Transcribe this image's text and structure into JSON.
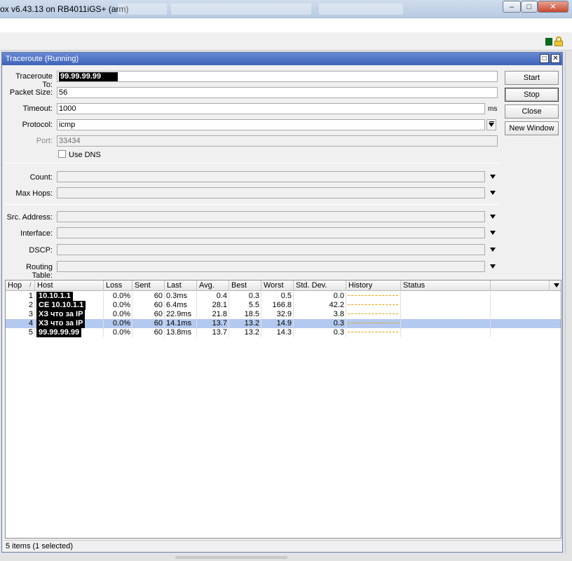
{
  "app": {
    "title": "ox v6.43.13 on RB4011iGS+ (arm)",
    "controls": {
      "minimize": "–",
      "maximize": "□",
      "close": "✕"
    },
    "accent": "#3f63b8"
  },
  "window": {
    "title": "Traceroute (Running)",
    "restore_glyph": "□",
    "close_glyph": "✕"
  },
  "form": {
    "traceroute_to": {
      "label": "Traceroute To:",
      "value": "99.99.99.99"
    },
    "packet_size": {
      "label": "Packet Size:",
      "value": "56"
    },
    "timeout": {
      "label": "Timeout:",
      "value": "1000",
      "unit": "ms"
    },
    "protocol": {
      "label": "Protocol:",
      "value": "icmp"
    },
    "port": {
      "label": "Port:",
      "value": "33434"
    },
    "use_dns": {
      "label": "Use DNS",
      "checked": false
    },
    "count": {
      "label": "Count:",
      "value": ""
    },
    "max_hops": {
      "label": "Max Hops:",
      "value": ""
    },
    "src_address": {
      "label": "Src. Address:",
      "value": ""
    },
    "interface": {
      "label": "Interface:",
      "value": ""
    },
    "dscp": {
      "label": "DSCP:",
      "value": ""
    },
    "routing_table": {
      "label": "Routing Table:",
      "value": ""
    }
  },
  "buttons": {
    "start": "Start",
    "stop": "Stop",
    "close": "Close",
    "new_window": "New Window"
  },
  "table": {
    "columns": [
      "Hop",
      "Host",
      "Loss",
      "Sent",
      "Last",
      "Avg.",
      "Best",
      "Worst",
      "Std. Dev.",
      "History",
      "Status"
    ],
    "sort_indicator": "/",
    "rows": [
      {
        "hop": "1",
        "host": "10.10.1.1",
        "loss": "0.0%",
        "sent": "60",
        "last": "0.3ms",
        "avg": "0.4",
        "best": "0.3",
        "worst": "0.5",
        "std": "0.0",
        "status": ""
      },
      {
        "hop": "2",
        "host": "CE 10.10.1.1",
        "loss": "0.0%",
        "sent": "60",
        "last": "6.4ms",
        "avg": "28.1",
        "best": "5.5",
        "worst": "166.8",
        "std": "42.2",
        "status": ""
      },
      {
        "hop": "3",
        "host": "ХЗ что за IP",
        "loss": "0.0%",
        "sent": "60",
        "last": "22.9ms",
        "avg": "21.8",
        "best": "18.5",
        "worst": "32.9",
        "std": "3.8",
        "status": ""
      },
      {
        "hop": "4",
        "host": "ХЗ что за IP",
        "loss": "0.0%",
        "sent": "60",
        "last": "14.1ms",
        "avg": "13.7",
        "best": "13.2",
        "worst": "14.9",
        "std": "0.3",
        "status": "",
        "selected": true
      },
      {
        "hop": "5",
        "host": "99.99.99.99",
        "loss": "0.0%",
        "sent": "60",
        "last": "13.8ms",
        "avg": "13.7",
        "best": "13.2",
        "worst": "14.3",
        "std": "0.3",
        "status": ""
      }
    ],
    "selected_color": "#b4c9ef",
    "history_color": "#e3a300"
  },
  "footer": {
    "status": "5 items (1 selected)"
  }
}
